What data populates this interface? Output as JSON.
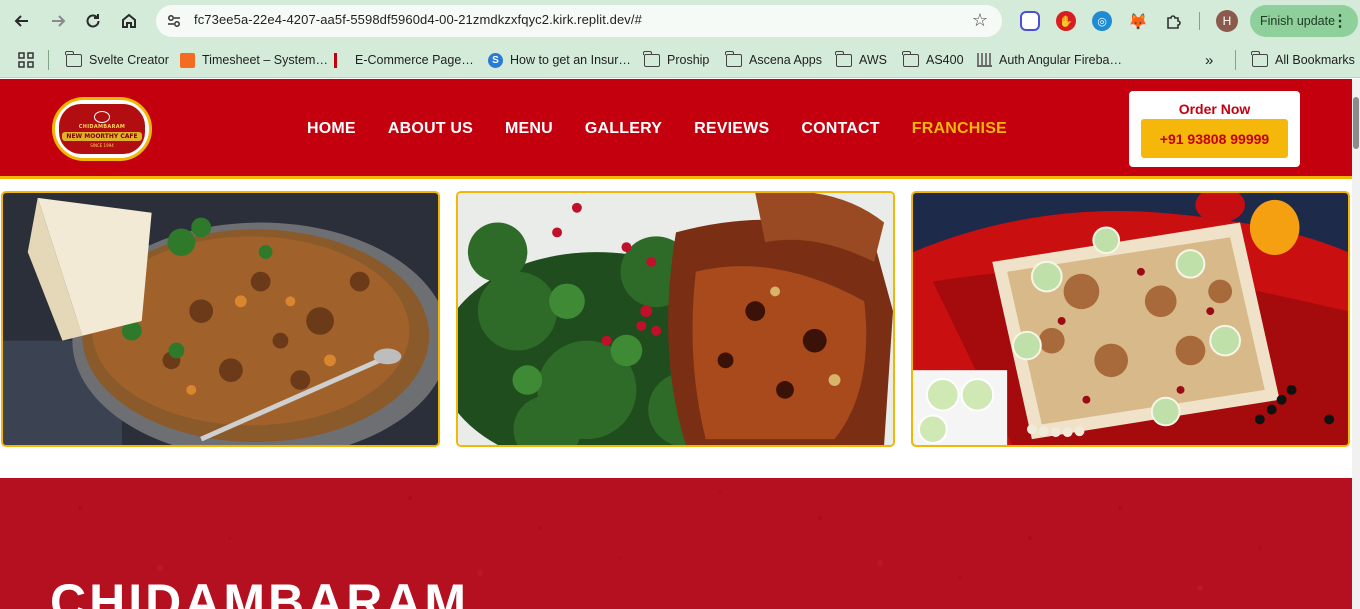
{
  "browser": {
    "url": "fc73ee5a-22e4-4207-aa5f-5598df5960d4-00-21zmdkzxfqyc2.kirk.replit.dev/#",
    "profile_initial": "H",
    "finish_update_label": "Finish update",
    "bookmarks": [
      {
        "label": "Svelte Creator",
        "icon": "folder-icon"
      },
      {
        "label": "Timesheet – System…",
        "icon": "timesheet-icon"
      },
      {
        "label": "E-Commerce Page…",
        "icon": "ecommerce-icon"
      },
      {
        "label": "How to get an Insur…",
        "icon": "s-logo-icon"
      },
      {
        "label": "Proship",
        "icon": "folder-icon"
      },
      {
        "label": "Ascena Apps",
        "icon": "folder-icon"
      },
      {
        "label": "AWS",
        "icon": "folder-icon"
      },
      {
        "label": "AS400",
        "icon": "folder-icon"
      },
      {
        "label": "Auth Angular Fireba…",
        "icon": "building-icon"
      }
    ],
    "more_bookmarks": "»",
    "all_bookmarks_label": "All Bookmarks"
  },
  "site": {
    "logo": {
      "top_text": "CHIDAMBARAM",
      "name": "NEW MOORTHY CAFE",
      "sub_text": "SINCE 1994"
    },
    "nav": [
      "HOME",
      "ABOUT US",
      "MENU",
      "GALLERY",
      "REVIEWS",
      "CONTACT",
      "FRANCHISE"
    ],
    "active_nav": "FRANCHISE",
    "order": {
      "title": "Order Now",
      "phone": "+91 93808 99999"
    },
    "accent_colors": {
      "red": "#c4000f",
      "gold": "#f2b705"
    },
    "gallery": [
      {
        "name": "gallery-image-mutton-fry",
        "subject": "pan of spiced meat fry with naan"
      },
      {
        "name": "gallery-image-grilled-chicken",
        "subject": "grilled chicken with kale and pomegranate"
      },
      {
        "name": "gallery-image-biryani",
        "subject": "biryani platter with cucumber and eggs"
      }
    ],
    "hero_title": "CHIDAMBARAM"
  }
}
